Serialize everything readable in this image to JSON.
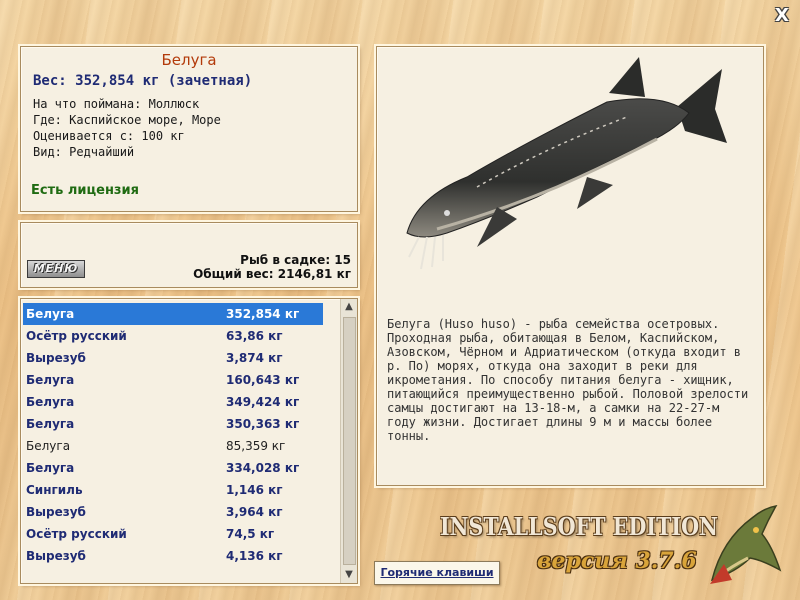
{
  "window": {
    "close_glyph": "X"
  },
  "info": {
    "title": "Белуга",
    "weight": "Вес: 352,854 кг (зачетная)",
    "caught_on": "На что поймана: Моллюск",
    "where": "Где: Каспийское море, Море",
    "rated_from": "Оценивается с: 100 кг",
    "kind": "Вид: Редчайший",
    "license": "Есть лицензия"
  },
  "cage": {
    "menu_label": "МЕНЮ",
    "fish_count": "Рыб в садке: 15",
    "total_weight": "Общий вес: 2146,81 кг"
  },
  "catch_list": {
    "rows": [
      {
        "name": "Белуга",
        "weight": "352,854 кг"
      },
      {
        "name": "Осётр русский",
        "weight": "63,86 кг"
      },
      {
        "name": "Вырезуб",
        "weight": "3,874 кг"
      },
      {
        "name": "Белуга",
        "weight": "160,643 кг"
      },
      {
        "name": "Белуга",
        "weight": "349,424 кг"
      },
      {
        "name": "Белуга",
        "weight": "350,363 кг"
      },
      {
        "name": "Белуга",
        "weight": "85,359 кг"
      },
      {
        "name": "Белуга",
        "weight": "334,028 кг"
      },
      {
        "name": "Сингиль",
        "weight": "1,146 кг"
      },
      {
        "name": "Вырезуб",
        "weight": "3,964 кг"
      },
      {
        "name": "Осётр русский",
        "weight": "74,5 кг"
      },
      {
        "name": "Вырезуб",
        "weight": "4,136 кг"
      }
    ]
  },
  "description": "Белуга (Huso huso) - рыба семейства осетровых. Проходная рыба, обитающая в Белом, Каспийском, Азовском, Чёрном и Адриатическом (откуда входит в р. По) морях, откуда она заходит в реки для икрометания. По способу питания белуга - хищник, питающийся преимущественно рыбой. Половой зрелости самцы достигают на 13-18-м, а самки на 22-27-м году жизни. Достигает длины 9 м и массы более тонны.",
  "footer": {
    "hotkeys_label": "Горячие клавиши",
    "brand": "INSTALLSOFT EDITION",
    "version": "версия 3.7.6"
  },
  "colors": {
    "accent_title": "#b33a0a",
    "list_text": "#1f2b74",
    "selection": "#2a79d7",
    "license_green": "#1f6b12"
  },
  "icons": [
    "close-icon",
    "sturgeon-image",
    "pike-logo",
    "scroll-up-icon",
    "scroll-down-icon"
  ]
}
